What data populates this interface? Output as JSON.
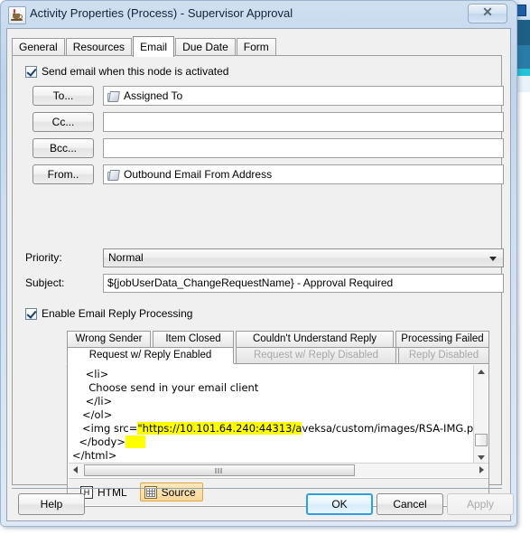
{
  "window": {
    "title": "Activity Properties (Process) - Supervisor Approval",
    "app_icon": "java-coffee-cup-icon",
    "close_label": "✕"
  },
  "outer_tabs": [
    {
      "label": "General",
      "active": false
    },
    {
      "label": "Resources",
      "active": false
    },
    {
      "label": "Email",
      "active": true
    },
    {
      "label": "Due Date",
      "active": false
    },
    {
      "label": "Form",
      "active": false
    }
  ],
  "send_email_checkbox": {
    "label": "Send email when this node is activated",
    "checked": true
  },
  "address_fields": [
    {
      "button": "To...",
      "value": "Assigned To",
      "has_icon": true
    },
    {
      "button": "Cc...",
      "value": "",
      "has_icon": false
    },
    {
      "button": "Bcc...",
      "value": "",
      "has_icon": false
    },
    {
      "button": "From..",
      "value": "Outbound Email From Address",
      "has_icon": true
    }
  ],
  "priority": {
    "label": "Priority:",
    "value": "Normal",
    "options": [
      "Normal"
    ]
  },
  "subject": {
    "label": "Subject:",
    "value": "${jobUserData_ChangeRequestName} - Approval Required",
    "placeholder": ""
  },
  "reply_processing_checkbox": {
    "label": "Enable Email Reply Processing",
    "checked": true
  },
  "inner_tabs_top": [
    {
      "label": "Wrong Sender",
      "width": 93,
      "disabled": false,
      "active": false
    },
    {
      "label": "Item Closed",
      "width": 90,
      "disabled": false,
      "active": false
    },
    {
      "label": "Couldn't Understand Reply",
      "width": 175,
      "disabled": false,
      "active": false
    },
    {
      "label": "Processing Failed",
      "width": 104,
      "disabled": false,
      "active": false
    }
  ],
  "inner_tabs_bottom": [
    {
      "label": "Request w/ Reply Enabled",
      "width": 185,
      "disabled": false,
      "active": true
    },
    {
      "label": "Request w/ Reply Disabled",
      "width": 178,
      "disabled": true,
      "active": false
    },
    {
      "label": "Reply Disabled",
      "width": 101,
      "disabled": true,
      "active": false
    }
  ],
  "editor": {
    "lines": [
      {
        "indent": 4,
        "segments": [
          {
            "text": "<li>",
            "highlight": false
          }
        ]
      },
      {
        "indent": 5,
        "segments": [
          {
            "text": "Choose send in your email client",
            "highlight": false
          }
        ]
      },
      {
        "indent": 4,
        "segments": [
          {
            "text": "</li>",
            "highlight": false
          }
        ]
      },
      {
        "indent": 3,
        "segments": [
          {
            "text": "</ol>",
            "highlight": false
          }
        ]
      },
      {
        "indent": 3,
        "segments": [
          {
            "text": "<img src=",
            "highlight": false
          },
          {
            "text": "\"https://10.101.64.240:44313/a",
            "highlight": true
          },
          {
            "text": "veksa/custom/images/RSA-IMG.png\">",
            "highlight": false
          }
        ]
      },
      {
        "indent": 2,
        "segments": [
          {
            "text": "</body>",
            "highlight": false
          },
          {
            "text": "      ",
            "highlight": true
          }
        ]
      },
      {
        "indent": 0,
        "segments": [
          {
            "text": "</html>",
            "highlight": false
          }
        ]
      },
      {
        "indent": 0,
        "caret": true,
        "segments": []
      }
    ],
    "highlight_color": "#ffff00"
  },
  "editor_toggles": [
    {
      "label": "HTML",
      "icon": "html-icon",
      "selected": false
    },
    {
      "label": "Source",
      "icon": "source-grid-icon",
      "selected": true
    }
  ],
  "scrollbars": {
    "vertical_thumb_pos_pct": 72,
    "horizontal_thumb_pos_pct": 4
  },
  "dialog_buttons": {
    "help": "Help",
    "ok": "OK",
    "cancel": "Cancel",
    "apply": "Apply",
    "apply_disabled": true,
    "ok_is_default": true
  },
  "colors": {
    "dialog_bg": "#f0f0f0",
    "titlebar": "#cfdff0",
    "accent_focus": "#2f9fe0",
    "highlight": "#ffff00",
    "toggle_selected": "#fad79a"
  }
}
